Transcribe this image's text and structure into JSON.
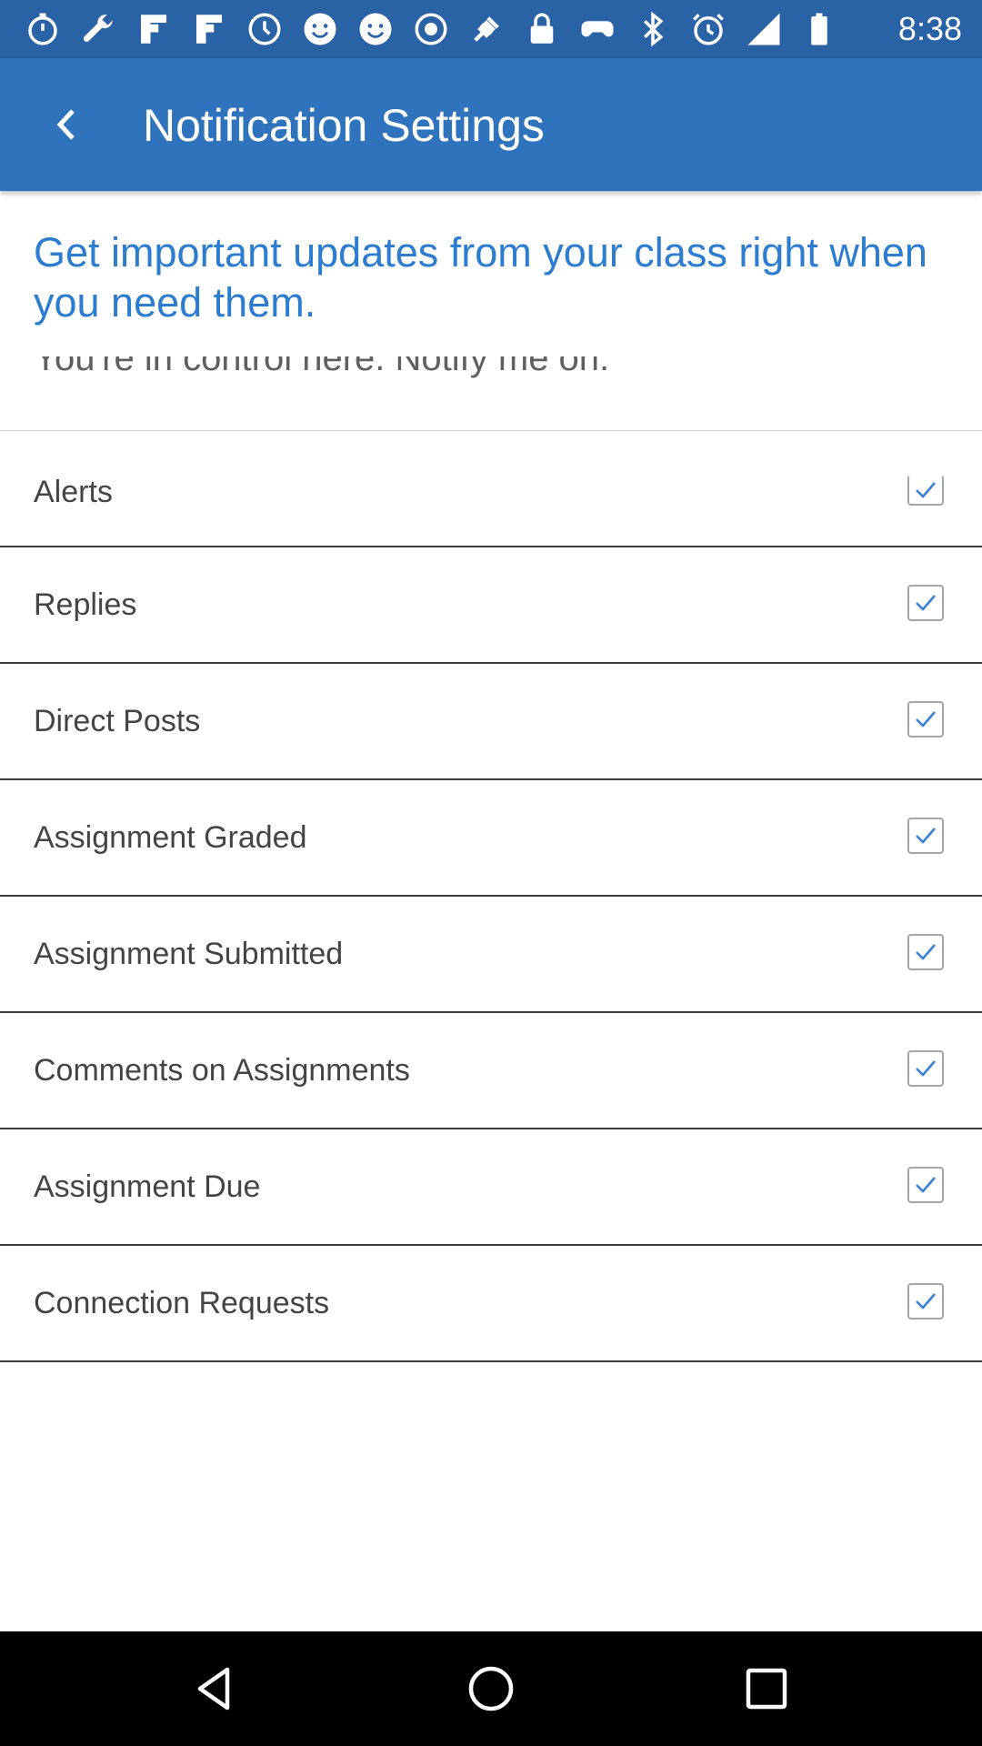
{
  "status_bar": {
    "time": "8:38",
    "icons": [
      "stopwatch-icon",
      "wrench-icon",
      "flipboard-icon",
      "flipboard-icon",
      "clock-icon",
      "smiley-icon",
      "smiley-icon",
      "record-icon",
      "fake-gps-icon",
      "lock-icon",
      "gamepad-icon",
      "bluetooth-icon",
      "alarm-icon",
      "cellular-signal-icon",
      "battery-icon"
    ]
  },
  "app_bar": {
    "back_icon": "back-arrow-icon",
    "title": "Notification Settings",
    "background": "#3073bd"
  },
  "intro": {
    "headline": "Get important updates from your class right when you need them.",
    "subtext": "You're in control here. Notify me on:"
  },
  "settings": [
    {
      "label": "Alerts",
      "checked": true
    },
    {
      "label": "Replies",
      "checked": true
    },
    {
      "label": "Direct Posts",
      "checked": true
    },
    {
      "label": "Assignment Graded",
      "checked": true
    },
    {
      "label": "Assignment Submitted",
      "checked": true
    },
    {
      "label": "Comments on Assignments",
      "checked": true
    },
    {
      "label": "Assignment Due",
      "checked": true
    },
    {
      "label": "Connection Requests",
      "checked": true
    }
  ],
  "nav_bar": {
    "icons": [
      "back-triangle-icon",
      "home-circle-icon",
      "recents-square-icon"
    ]
  },
  "colors": {
    "accent": "#2c7cd0",
    "check": "#3b82d6"
  }
}
